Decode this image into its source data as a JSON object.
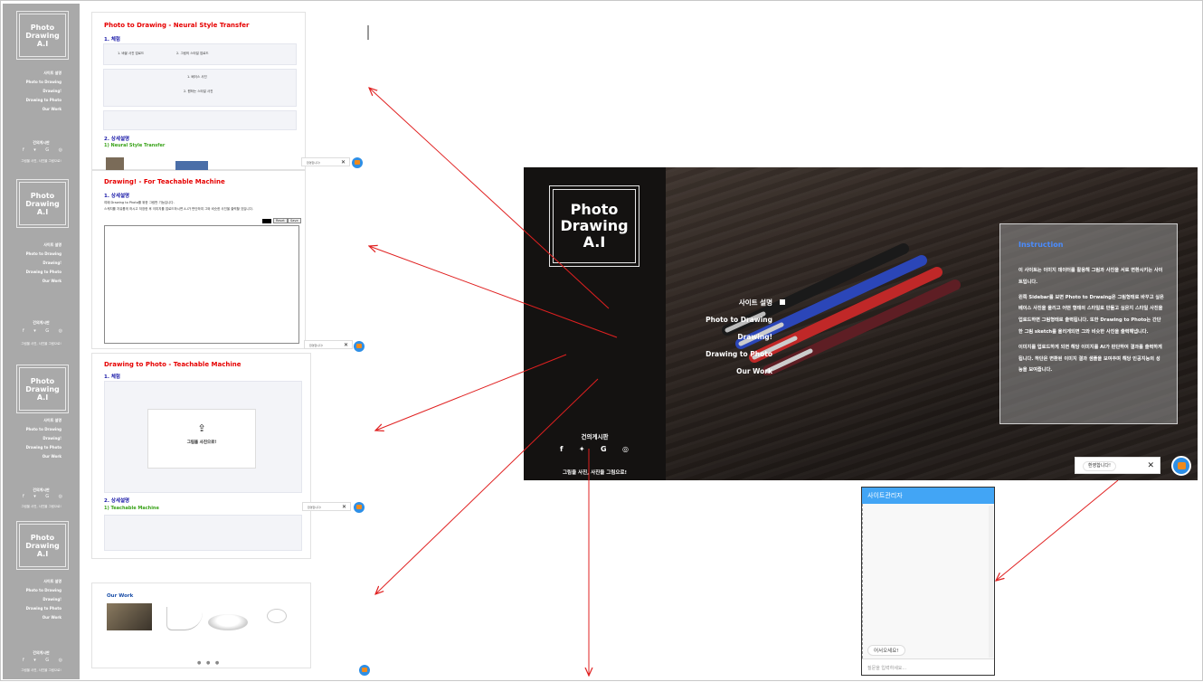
{
  "site": {
    "logo": "Photo\nDrawing\nA.I",
    "nav": [
      "사이트 설명",
      "Photo to Drawing",
      "Drawing!",
      "Drawing to Photo",
      "Our Work"
    ],
    "footer_title": "건의게시판",
    "social": [
      "f",
      "🐦",
      "G",
      "◎"
    ],
    "footer_text": "그림을 사진, 사진을 그림으로!"
  },
  "instruction": {
    "title": "Instruction",
    "p1": "이 사이트는 이미지 데이터를 활용해 그림과 사진을 서로 변환시키는 사이트입니다.",
    "p2": "왼쪽 Sidebar를 보면 Photo to Drwaing은 그림형태로 바꾸고 싶은 베이스 사진을 올리고 어떤 형태의 스타일로 만들고 싶은지 스타일 사진을 업로드하면 그림형태로 출력됩니다. 또한 Drawing to Photo는 간단한 그림 sketch를 올리게되면 그와 비슷한 사진을 출력해냅니다.",
    "p3": "이미지를 업로드하게 되면 해당 이미지를 AI가 판단하여 결과를 출력하게 됩니다. 하단은 변환된 이미지 결과 샘플을 보여주며 해당 인공지능의 성능을 보여줍니다."
  },
  "chat": {
    "welcome": "환영합니다!",
    "close": "✕",
    "panel_title": "사이트관리자",
    "greeting": "어서오세요!",
    "input_placeholder": "질문을 입력하세요..."
  },
  "mini_pages": {
    "p1": {
      "title": "Photo to Drawing - Neural Style Transfer",
      "h1": "1. 체험",
      "btn_a": "1. 바꿀 사진 업로드",
      "btn_b": "2. 그림의 스타일 업로드",
      "line_a": "1. 베이스 사진",
      "line_b": "2. 원하는 스타일 사진",
      "h2": "2. 상세설명",
      "green": "1) Neural Style Transfer"
    },
    "p2": {
      "title": "Drawing! - For Teachable Machine",
      "h1": "1. 상세설명",
      "desc1": "여때 Drawing to Photo를 위한 그림판 기능입니다.",
      "desc2": "스케치를 자유롭게 하시고 저장한 후 이미지를 업로드하시면 A.I가 판단하여 그와 비슷한 사진을 출력할 것입니다.",
      "reset": "Reset",
      "save": "Save"
    },
    "p3": {
      "title": "Drawing to Photo - Teachable Machine",
      "h1": "1. 체험",
      "upload": "그림을 사진으로!",
      "h2": "2. 상세설명",
      "green": "1) Teachable Machine"
    },
    "p4": {
      "title": "Our Work"
    }
  }
}
